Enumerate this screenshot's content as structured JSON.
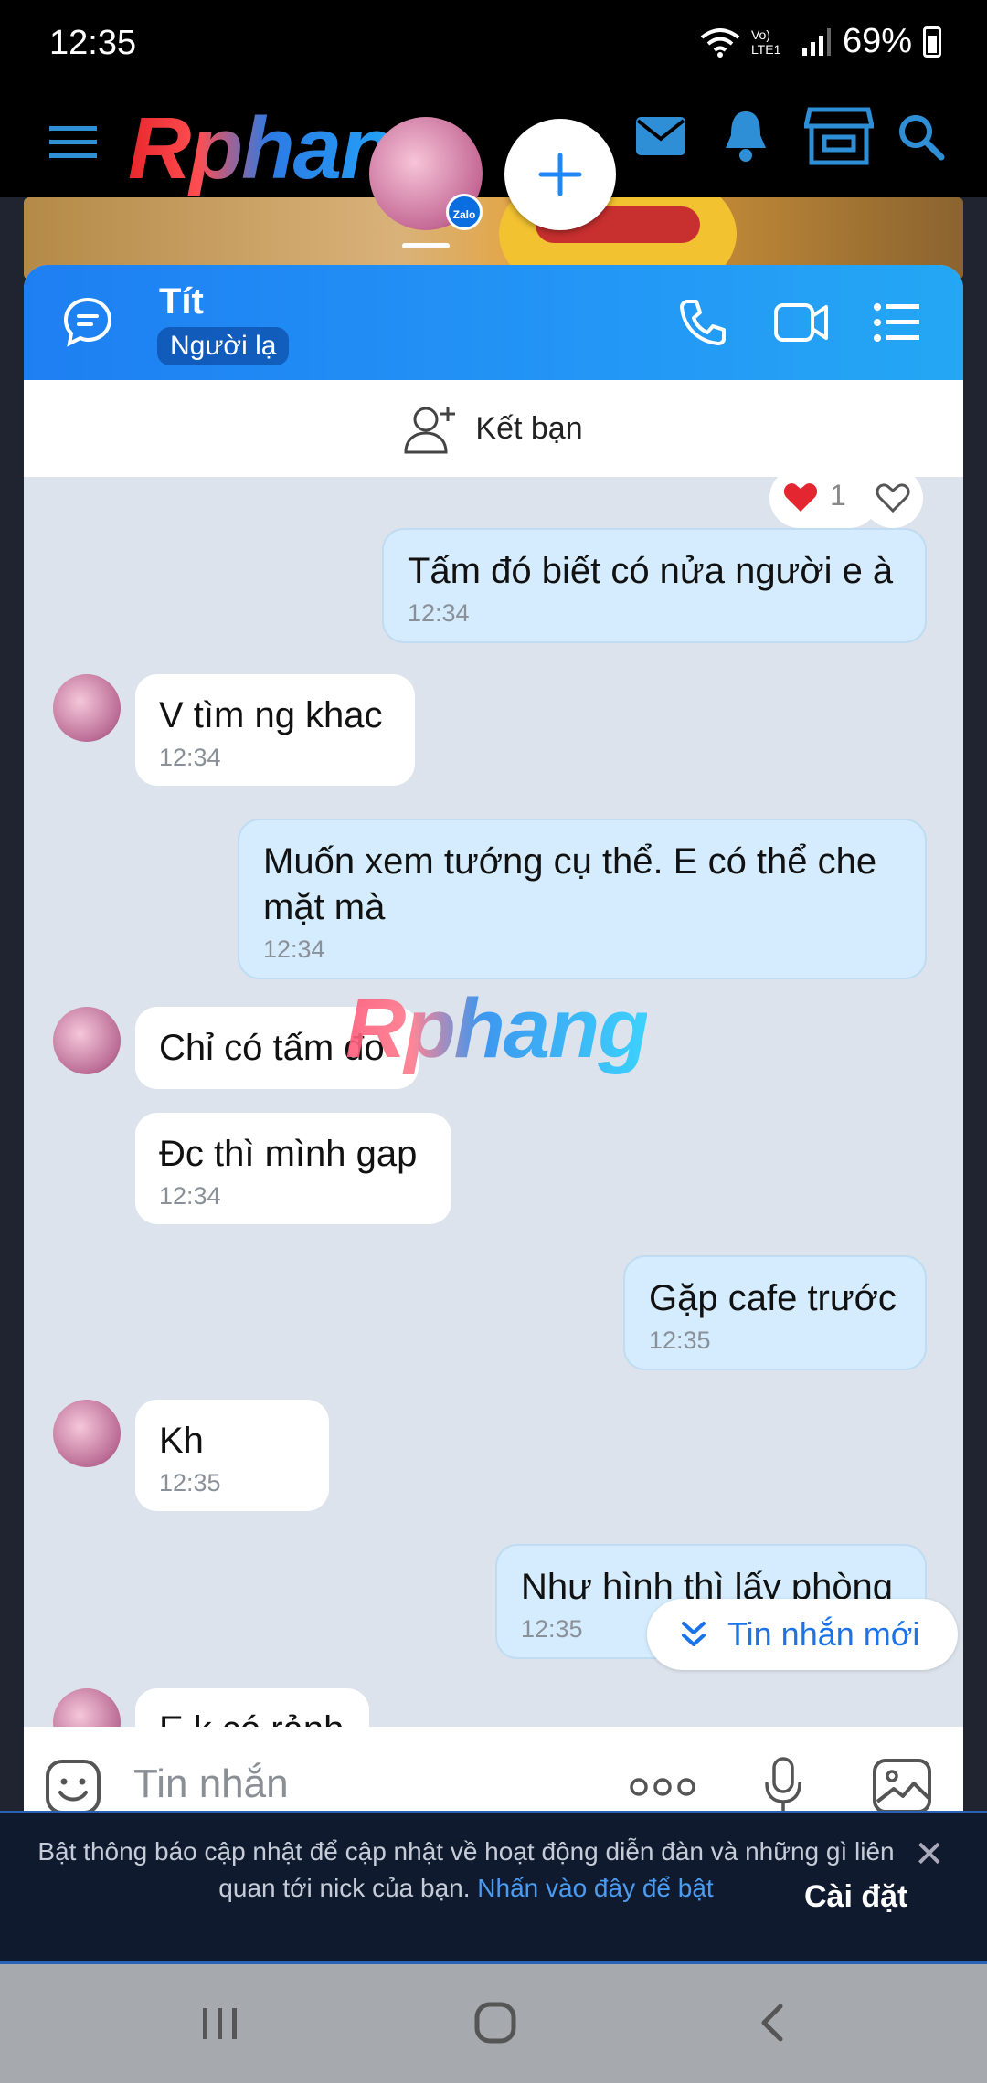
{
  "status_bar": {
    "time": "12:35",
    "battery": "69%",
    "network": "Vo) LTE1"
  },
  "forum": {
    "logo_text": "Rphang"
  },
  "chat": {
    "contact_name": "Tít",
    "contact_tag": "Người lạ",
    "add_friend_label": "Kết bạn",
    "reaction_count": "1",
    "messages": [
      {
        "dir": "out",
        "text": "Tấm đó biết có nửa người e à",
        "time": "12:34"
      },
      {
        "dir": "in",
        "text": "V tìm ng khac",
        "time": "12:34"
      },
      {
        "dir": "out",
        "text": "Muốn xem tướng cụ thể. E có thể che mặt mà",
        "time": "12:34"
      },
      {
        "dir": "in",
        "text": "Chỉ có tấm đo",
        "time": ""
      },
      {
        "dir": "in",
        "text": "Đc thì mình gap",
        "time": "12:34"
      },
      {
        "dir": "out",
        "text": "Gặp cafe trước",
        "time": "12:35"
      },
      {
        "dir": "in",
        "text": "Kh",
        "time": "12:35"
      },
      {
        "dir": "out",
        "text": "Như hình thì lấy phòng",
        "time": "12:35"
      },
      {
        "dir": "in",
        "text": "E k có rảnh",
        "time": ""
      }
    ],
    "watermark": "Rphang",
    "new_messages_label": "Tin nhắn mới",
    "composer_placeholder": "Tin nhắn"
  },
  "notification": {
    "text": "Bật thông báo cập nhật để cập nhật về hoạt động diễn đàn và những gì liên quan tới nick của bạn.",
    "link": "Nhấn vào đây để bật",
    "settings": "Cài đặt"
  },
  "colors": {
    "header_blue": "#1e88f5",
    "outgoing_bubble": "#d4ecfd",
    "chat_bg": "#dce3ec",
    "link_blue": "#1a73e8"
  }
}
